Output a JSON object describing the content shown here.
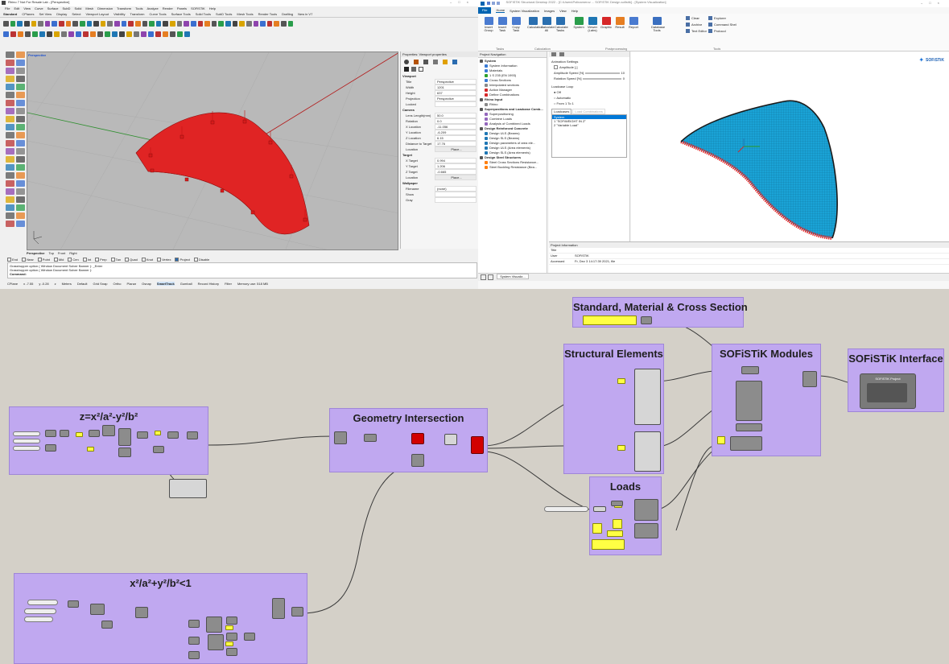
{
  "colors": {
    "rhino_surface": "#e02424",
    "viewport_bg": "#b9b9b9",
    "gh_canvas": "#d4d0c8",
    "gh_group": "#c0a8f0",
    "gh_param_yellow": "#ffff44",
    "gh_component": "#8c8c8c",
    "sofi_blue": "#0063b1",
    "sofi_mesh": "#1aa3d6"
  },
  "rhino": {
    "title": "Rhino 7 Not For Resale Lab - [Perspective]",
    "menu": [
      "File",
      "Edit",
      "View",
      "Curve",
      "Surface",
      "SubD",
      "Solid",
      "Mesh",
      "Dimension",
      "Transform",
      "Tools",
      "Analyze",
      "Render",
      "Panels",
      "SOFiSTiK",
      "Help"
    ],
    "tabs": [
      "Standard",
      "CPlanes",
      "Set View",
      "Display",
      "Select",
      "Viewport Layout",
      "Visibility",
      "Transform",
      "Curve Tools",
      "Surface Tools",
      "Solid Tools",
      "SubD Tools",
      "Mesh Tools",
      "Render Tools",
      "Drafting",
      "New in V7"
    ],
    "viewport_label": "Perspective",
    "viewport_tabs": [
      "Perspective",
      "Top",
      "Front",
      "Right"
    ],
    "osnaps": [
      "End",
      "Near",
      "Point",
      "Mid",
      "Cen",
      "Int",
      "Perp",
      "Tan",
      "Quad",
      "Knot",
      "Vertex",
      "Project",
      "Disable"
    ],
    "command_history": [
      "Grasshopper option ( Window  Document  Solver  Banner ): _Enter",
      "Grasshopper option ( Window  Document  Solver  Banner ):"
    ],
    "command_prompt": "Command:",
    "status": [
      "CPlane",
      "x -7.55",
      "y -0.28",
      "z",
      "Meters",
      "Default",
      "Grid Snap",
      "Ortho",
      "Planar",
      "Osnap",
      "SmartTrack",
      "Gumball",
      "Record History",
      "Filter",
      "Memory use: 518 MB"
    ],
    "properties": {
      "header": "Properties: Viewport properties",
      "section_viewport": "Viewport",
      "viewport_rows": [
        {
          "k": "Title",
          "v": "Perspective"
        },
        {
          "k": "Width",
          "v": "1201"
        },
        {
          "k": "Height",
          "v": "637"
        },
        {
          "k": "Projection",
          "v": "Perspective"
        },
        {
          "k": "Locked",
          "v": ""
        }
      ],
      "section_camera": "Camera",
      "camera_rows": [
        {
          "k": "Lens Length(mm)",
          "v": "50.0"
        },
        {
          "k": "Rotation",
          "v": "0.0"
        },
        {
          "k": "X Location",
          "v": "-11.056"
        },
        {
          "k": "Y Location",
          "v": "-6.209"
        },
        {
          "k": "Z Location",
          "v": "6.15"
        },
        {
          "k": "Distance to Target",
          "v": "17.76"
        },
        {
          "k": "Location",
          "v": "Place..."
        }
      ],
      "section_target": "Target",
      "target_rows": [
        {
          "k": "X Target",
          "v": "0.994"
        },
        {
          "k": "Y Target",
          "v": "1.206"
        },
        {
          "k": "Z Target",
          "v": "-0.665"
        },
        {
          "k": "Location",
          "v": "Place..."
        }
      ],
      "section_wallpaper": "Wallpaper",
      "wallpaper_rows": [
        {
          "k": "Filename",
          "v": "(none)"
        },
        {
          "k": "Show",
          "v": ""
        },
        {
          "k": "Gray",
          "v": ""
        }
      ]
    }
  },
  "sofi": {
    "title": "SOFiSTiK Structural Desktop 2022 - [C:\\Users\\Polinamerov ... SOFiSTiK Design.sofistik] - [System Visualization]",
    "tabs": [
      "File",
      "Home",
      "System Visualization",
      "Images",
      "View",
      "Help"
    ],
    "ribbon": [
      {
        "label": "Insert Group"
      },
      {
        "label": "Insert Task"
      },
      {
        "label": "Copy Task"
      },
      {
        "label": "Calculation"
      },
      {
        "label": "Calculate All"
      },
      {
        "label": "Calculate Tasks"
      },
      {
        "label": "System"
      },
      {
        "label": "Viewer (Labs)"
      },
      {
        "label": "Graphic"
      },
      {
        "label": "Result"
      },
      {
        "label": "Report"
      },
      {
        "label": "Database Tools"
      }
    ],
    "ribbon_right": [
      "Clean",
      "Archive",
      "Text Editor",
      "Explorer",
      "Command Shell",
      "Protocol"
    ],
    "groups": [
      "Tasks",
      "Calculation",
      "Postprocessing",
      "Tools"
    ],
    "nav_header": "Project Navigation",
    "tree": [
      {
        "t": "System",
        "b": true,
        "c": "#555"
      },
      {
        "t": "System Information",
        "c": "#3a7bd5"
      },
      {
        "t": "Materials",
        "c": "#3a7bd5"
      },
      {
        "t": "1 S 235 (EN 1993)",
        "c": "#2ca02c"
      },
      {
        "t": "Cross Sections",
        "c": "#3a7bd5"
      },
      {
        "t": "Interpolated sections",
        "c": "#888"
      },
      {
        "t": "Action Manager",
        "c": "#d62728"
      },
      {
        "t": "Define Combinations",
        "c": "#d62728"
      },
      {
        "t": "Rhino Input",
        "b": true,
        "c": "#555"
      },
      {
        "t": "Rhino",
        "c": "#888"
      },
      {
        "t": "Superpositions and Loadcase Comb...",
        "b": true,
        "c": "#555"
      },
      {
        "t": "Superpositioning",
        "c": "#9467bd"
      },
      {
        "t": "Combine Loads",
        "c": "#9467bd"
      },
      {
        "t": "Analysis of Combined Loads",
        "c": "#9467bd"
      },
      {
        "t": "Design Reinforced Concrete",
        "b": true,
        "c": "#555"
      },
      {
        "t": "Design ULS (Beams)",
        "c": "#1f77b4"
      },
      {
        "t": "Design SLS (Beams)",
        "c": "#1f77b4"
      },
      {
        "t": "Design parameters of area ele...",
        "c": "#1f77b4"
      },
      {
        "t": "Design ULS (Area elements)",
        "c": "#1f77b4"
      },
      {
        "t": "Design SLS (Area elements)",
        "c": "#1f77b4"
      },
      {
        "t": "Design Steel Structures",
        "b": true,
        "c": "#555"
      },
      {
        "t": "Steel Cross Sections Resistance...",
        "c": "#ff7f0e"
      },
      {
        "t": "Steel Buckling Resistance (Bea...",
        "c": "#ff7f0e"
      }
    ],
    "anim": {
      "header": "Animation Settings",
      "amplitude": "Amplitude [-]",
      "amp_speed": "Amplitude Speed [%]",
      "amp_speed_val": "10",
      "rot_speed": "Rotation Speed [%]",
      "rot_speed_val": "0",
      "loop_header": "Loadcase Loop",
      "opt_off": "Off",
      "opt_auto": "Automatic",
      "opt_from": "From",
      "from_val": "1",
      "to_label": "To",
      "to_val": "1",
      "tab1": "Loadcases",
      "tab2": "Load Combinations",
      "list": [
        "System",
        "1 \"SOFiWEIGHT IN Z\"",
        "2 \"Variable Load\""
      ]
    },
    "logo": "SOFiSTiK",
    "projinfo": {
      "header": "Project Information",
      "rows": [
        {
          "k": "Title",
          "v": ""
        },
        {
          "k": "User",
          "v": "SOFiSTiK"
        },
        {
          "k": "Accessed",
          "v": "Fr, Dez 3 14:17:39 2021, file"
        }
      ]
    },
    "status_tab": "System Visualiz..."
  },
  "gh": {
    "groups": {
      "std": "Standard, Material & Cross Section",
      "struct": "Structural Elements",
      "modules": "SOFiSTiK Modules",
      "interface": "SOFiSTiK Interface",
      "surface": "z=x²/a²-y²/b²",
      "geom": "Geometry Intersection",
      "loads": "Loads",
      "boundary": "x²/a²+y²/b²<1"
    },
    "interface_title": "SOFiSTiK Project"
  }
}
